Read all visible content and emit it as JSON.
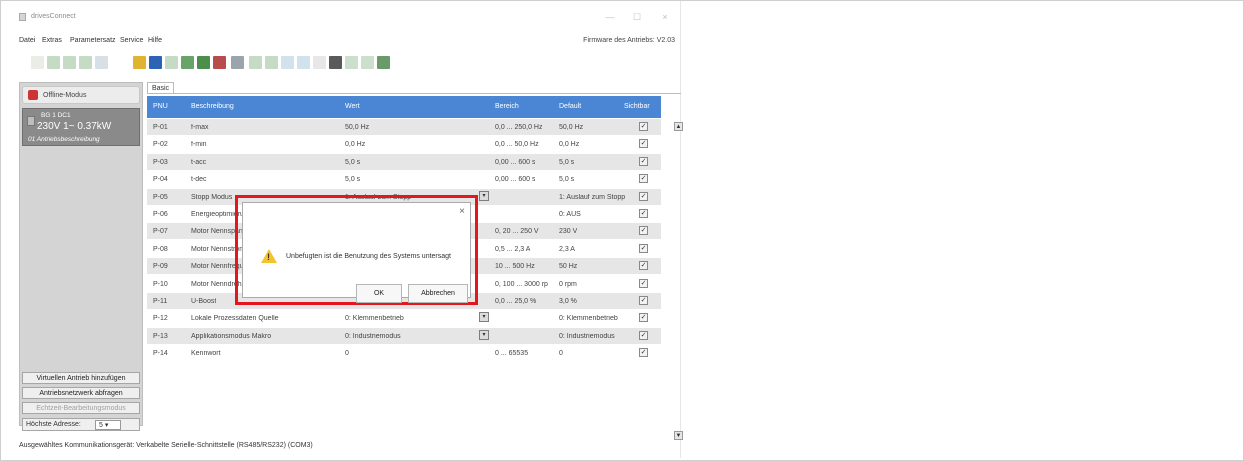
{
  "window": {
    "title": "drivesConnect",
    "minimize": "—",
    "maximize": "☐",
    "close": "×"
  },
  "menu": {
    "items": [
      "Datei",
      "Extras",
      "Parametersatz",
      "Service",
      "Hilfe"
    ],
    "firmware": "Firmware des Antriebs: V2.03"
  },
  "sidebar": {
    "offline_label": "Offline-Modus",
    "drive": {
      "line1": "BG 1  DC1",
      "line2": "230V 1~  0.37kW",
      "line3": "01   Antriebsbeschreibung"
    },
    "buttons": [
      "Virtuellen Antrieb hinzufügen",
      "Antriebsnetzwerk abfragen",
      "Echtzeit-Bearbeitungsmodus"
    ],
    "address_label": "Höchste Adresse:",
    "address_value": "5"
  },
  "tab": {
    "label": "Basic"
  },
  "table": {
    "headers": [
      "PNU",
      "Beschreibung",
      "Wert",
      "Bereich",
      "Default",
      "Sichtbar"
    ],
    "rows": [
      {
        "pnu": "P-01",
        "desc": "f-max",
        "value": "50,0 Hz",
        "range": "0,0 ... 250,0 Hz",
        "default": "50,0 Hz"
      },
      {
        "pnu": "P-02",
        "desc": "f-min",
        "value": "0,0 Hz",
        "range": "0,0 ... 50,0 Hz",
        "default": "0,0 Hz"
      },
      {
        "pnu": "P-03",
        "desc": "t-acc",
        "value": "5,0 s",
        "range": "0,00 ... 600 s",
        "default": "5,0 s"
      },
      {
        "pnu": "P-04",
        "desc": "t-dec",
        "value": "5,0 s",
        "range": "0,00 ... 600 s",
        "default": "5,0 s"
      },
      {
        "pnu": "P-05",
        "desc": "Stopp Modus",
        "value": "1: Auslauf zum Stopp",
        "range": "",
        "default": "1: Auslauf zum Stopp"
      },
      {
        "pnu": "P-06",
        "desc": "Energieoptimierung",
        "value": "",
        "range": "",
        "default": "0: AUS"
      },
      {
        "pnu": "P-07",
        "desc": "Motor Nennspannung",
        "value": "",
        "range": "0, 20 ... 250 V",
        "default": "230 V"
      },
      {
        "pnu": "P-08",
        "desc": "Motor Nennstrom",
        "value": "",
        "range": "0,5 ... 2,3 A",
        "default": "2,3 A"
      },
      {
        "pnu": "P-09",
        "desc": "Motor Nennfrequenz",
        "value": "",
        "range": "10 ... 500 Hz",
        "default": "50 Hz"
      },
      {
        "pnu": "P-10",
        "desc": "Motor Nenndrehzahl",
        "value": "",
        "range": "0, 100 ... 3000 rp",
        "default": "0 rpm"
      },
      {
        "pnu": "P-11",
        "desc": "U-Boost",
        "value": "",
        "range": "0,0 ... 25,0 %",
        "default": "3,0 %"
      },
      {
        "pnu": "P-12",
        "desc": "Lokale Prozessdaten Quelle",
        "value": "0: Klemmenbetrieb",
        "range": "",
        "default": "0: Klemmenbetrieb"
      },
      {
        "pnu": "P-13",
        "desc": "Applikationsmodus Makro",
        "value": "0: Industriemodus",
        "range": "",
        "default": "0: Industriemodus"
      },
      {
        "pnu": "P-14",
        "desc": "Kennwort",
        "value": "0",
        "range": "0 ... 65535",
        "default": "0"
      }
    ]
  },
  "dialog": {
    "message": "Unbefugten ist die Benutzung des Systems untersagt",
    "ok": "OK",
    "cancel": "Abbrechen",
    "close": "×"
  },
  "status": {
    "text": "Ausgewähltes Kommunikationsgerät: Verkabelte Serielle-Schnittstelle (RS485/RS232) (COM3)"
  },
  "colors": {
    "header_blue": "#4a86d4",
    "highlight_red": "#e2191c"
  }
}
